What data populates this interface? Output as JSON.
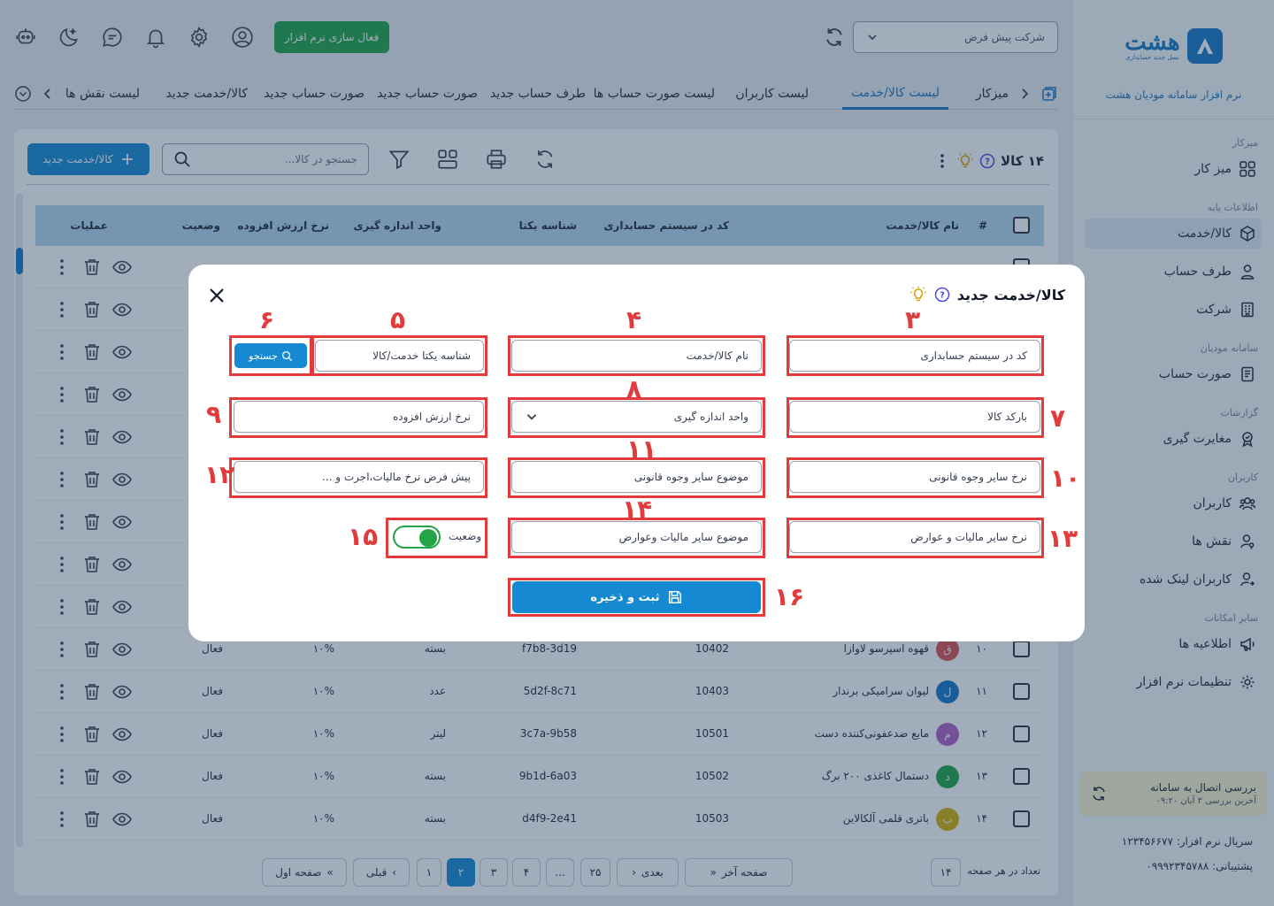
{
  "sidebar": {
    "brand_name": "هشت",
    "brand_tagline": "نسل جدید حسابداری",
    "brand_caption": "نرم افزار سامانه مودیان هشت",
    "sections": [
      {
        "title": "میزکار",
        "items": [
          {
            "label": "میز کار",
            "icon": "grid-icon"
          }
        ]
      },
      {
        "title": "اطلاعات پایه",
        "items": [
          {
            "label": "کالا/خدمت",
            "icon": "box-icon",
            "active": true
          },
          {
            "label": "طرف حساب",
            "icon": "user-icon"
          },
          {
            "label": "شرکت",
            "icon": "building-icon"
          }
        ]
      },
      {
        "title": "سامانه مودیان",
        "items": [
          {
            "label": "صورت حساب",
            "icon": "invoice-icon"
          }
        ]
      },
      {
        "title": "گزارشات",
        "items": [
          {
            "label": "مغایرت گیری",
            "icon": "badge-icon"
          }
        ]
      },
      {
        "title": "کاربران",
        "items": [
          {
            "label": "کاربران",
            "icon": "users-icon"
          },
          {
            "label": "نقش ها",
            "icon": "user-key-icon"
          },
          {
            "label": "کاربران لینک شده",
            "icon": "user-link-icon"
          }
        ]
      },
      {
        "title": "سایر امکانات",
        "items": [
          {
            "label": "اطلاعیه ها",
            "icon": "announce-icon"
          },
          {
            "label": "تنظیمات نرم افزار",
            "icon": "gear-icon"
          }
        ]
      }
    ],
    "connection_title": "بررسی اتصال به سامانه",
    "connection_last": "آخرین بررسی ۳ آبان ۰۹:۲۰",
    "serial": "سریال نرم افزار: ۱۲۳۴۵۶۶۷۷",
    "support": "پشتیبانی: ۰۹۹۹۲۳۴۵۷۸۸"
  },
  "topbar": {
    "company_select": "شرکت پیش فرض",
    "activate_label": "فعال سازی نرم افزار",
    "icons": [
      "user-circle-icon",
      "gear-icon",
      "bell-icon",
      "chat-icon",
      "moon-icon",
      "support-bot-icon"
    ]
  },
  "tabs": [
    {
      "label": "میزکار",
      "active": false
    },
    {
      "label": "لیست کالا/خدمت",
      "active": true
    },
    {
      "label": "لیست کاربران",
      "active": false
    },
    {
      "label": "لیست صورت حساب ها",
      "active": false
    },
    {
      "label": "طرف حساب جدید",
      "active": false
    },
    {
      "label": "صورت حساب جدید",
      "active": false
    },
    {
      "label": "صورت حساب جدید",
      "active": false
    },
    {
      "label": "کالا/خدمت جدید",
      "active": false
    },
    {
      "label": "لیست نقش ها",
      "active": false
    }
  ],
  "toolbar": {
    "count_label": "۱۴ کالا",
    "search_placeholder": "جستجو در کالا...",
    "new_button": "کالا/خدمت جدید"
  },
  "table": {
    "headers": {
      "index": "#",
      "name": "نام کالا/خدمت",
      "code": "کد در سیستم حسابداری",
      "uid": "شناسه یکتا",
      "unit": "واحد اندازه گیری",
      "vat": "نرخ ارزش افزوده",
      "status": "وضعیت",
      "ops": "عملیات"
    },
    "rows": [
      {
        "index": "۱۰",
        "avatar": "ق",
        "avatar_color": "#d9534f",
        "name": "قهوه اسپرسو لاوازا",
        "code": "10402",
        "uid": "f7b8-3d19",
        "unit": "بسته",
        "vat": "۱۰%",
        "status": "فعال"
      },
      {
        "index": "۱۱",
        "avatar": "ل",
        "avatar_color": "#1877c6",
        "name": "لیوان سرامیکی برندار",
        "code": "10403",
        "uid": "5d2f-8c71",
        "unit": "عدد",
        "vat": "۱۰%",
        "status": "فعال"
      },
      {
        "index": "۱۲",
        "avatar": "م",
        "avatar_color": "#b05fc4",
        "name": "مایع ضدعفونی‌کننده دست",
        "code": "10501",
        "uid": "3c7a-9b58",
        "unit": "لیتر",
        "vat": "۱۰%",
        "status": "فعال"
      },
      {
        "index": "۱۳",
        "avatar": "د",
        "avatar_color": "#22a447",
        "name": "دستمال کاغذی ۲۰۰ برگ",
        "code": "10502",
        "uid": "9b1d-6a03",
        "unit": "بسته",
        "vat": "۱۰%",
        "status": "فعال"
      },
      {
        "index": "۱۴",
        "avatar": "ب",
        "avatar_color": "#d4b106",
        "name": "باتری قلمی آلکالاین",
        "code": "10503",
        "uid": "d4f9-2e41",
        "unit": "بسته",
        "vat": "۱۰%",
        "status": "فعال"
      }
    ],
    "hidden_row_count": 9
  },
  "pagination": {
    "per_page_label": "تعداد در هر صفحه",
    "per_page_value": "۱۴",
    "last_page": "صفحه آخر",
    "next": "بعدی",
    "prev": "قبلی",
    "first_page": "صفحه اول",
    "pages": [
      "۲۵",
      "...",
      "۴",
      "۳",
      "۲",
      "۱"
    ],
    "current_page": "۲"
  },
  "modal": {
    "title": "کالا/خدمت جدید",
    "fields": {
      "accounting_code": "کد در سیستم حسابداری",
      "product_name": "نام کالا/خدمت",
      "unique_id": "شناسه یکتا خدمت/کالا",
      "search_button": "جستجو",
      "barcode": "بارکد کالا",
      "unit": "واحد اندازه گیری",
      "vat_rate": "نرخ ارزش افزوده",
      "other_legal_rate": "نرخ سایر  وجوه قانونی",
      "other_legal_subject": "موضوع سایر وجوه قانونی",
      "default_tax_rate": "پیش فرض نرخ مالیات،اجرت و ...",
      "other_tax_rate": "نرخ سایر مالیات و عوارض",
      "other_tax_subject": "موضوع سایر مالیات وعوارض",
      "status_label": "وضعیت",
      "save_button": "ثبت و ذخیره"
    },
    "status_on": true,
    "annotations": [
      "۳",
      "۴",
      "۵",
      "۶",
      "۷",
      "۸",
      "۹",
      "۱۰",
      "۱۱",
      "۱۲",
      "۱۳",
      "۱۴",
      "۱۵",
      "۱۶"
    ]
  },
  "colors": {
    "primary": "#1589d2",
    "brand": "#1877c6",
    "success": "#22a447",
    "annotation": "#e23b3b",
    "table_header": "#b3d6ef"
  }
}
